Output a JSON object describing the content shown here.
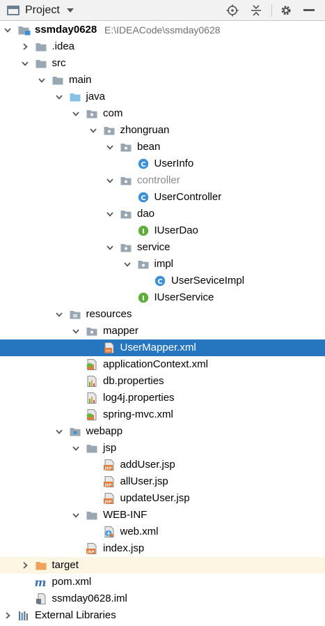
{
  "header": {
    "title": "Project",
    "buttons": [
      "locate-icon",
      "collapse-all-icon",
      "settings-gear-icon",
      "hide-icon"
    ]
  },
  "tree": {
    "root_label": "ssmday0628",
    "root_path": "E:\\IDEACode\\ssmday0628",
    "idea": ".idea",
    "src": "src",
    "main": "main",
    "java": "java",
    "com": "com",
    "zhongruan": "zhongruan",
    "bean": "bean",
    "userinfo": "UserInfo",
    "controller": "controller",
    "usercontroller": "UserController",
    "dao": "dao",
    "iuserdao": "IUserDao",
    "service": "service",
    "impl": "impl",
    "userserviceimpl": "UserSeviceImpl",
    "iuserservice": "IUserService",
    "resources": "resources",
    "mapper": "mapper",
    "usermapper": "UserMapper.xml",
    "appcontext": "applicationContext.xml",
    "dbprops": "db.properties",
    "log4j": "log4j.properties",
    "springmvc": "spring-mvc.xml",
    "webapp": "webapp",
    "jsp": "jsp",
    "adduser": "addUser.jsp",
    "alluser": "allUser.jsp",
    "updateuser": "updateUser.jsp",
    "webinf": "WEB-INF",
    "webxml": "web.xml",
    "indexjsp": "index.jsp",
    "target": "target",
    "pomxml": "pom.xml",
    "iml": "ssmday0628.iml",
    "extlibs": "External Libraries"
  },
  "colors": {
    "selection": "#2675bf",
    "folder": "#9aa7b0",
    "source_folder": "#87c3e6",
    "target_folder": "#f0a15a",
    "class_icon": "#3d8fd6",
    "interface_icon": "#5fae3c",
    "excluded_row": "#fdf6e3"
  }
}
